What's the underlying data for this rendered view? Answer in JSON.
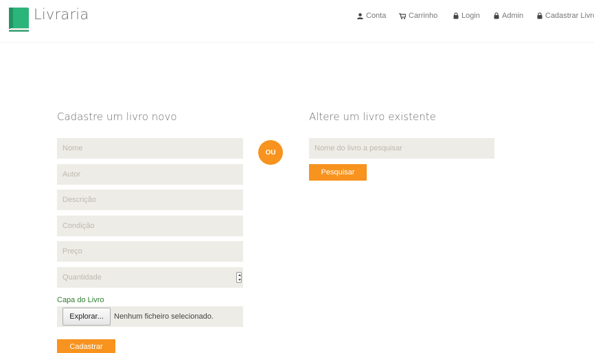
{
  "brand": {
    "name": "Livraria",
    "accent_color": "#f7931e",
    "logo_icon": "book-icon"
  },
  "nav": {
    "items": [
      {
        "label": "Conta",
        "icon": "user-icon"
      },
      {
        "label": "Carrinho",
        "icon": "cart-icon"
      },
      {
        "label": "Login",
        "icon": "lock-icon"
      },
      {
        "label": "Admin",
        "icon": "lock-icon"
      },
      {
        "label": "Cadastrar Livro",
        "icon": "lock-icon"
      }
    ]
  },
  "new_book": {
    "title": "Cadastre um livro novo",
    "fields": {
      "nome": "Nome",
      "autor": "Autor",
      "descricao": "Descrição",
      "condicao": "Condição",
      "preco": "Preço",
      "quantidade": "Quantidade"
    },
    "cover_label": "Capa do Livro",
    "file_button": "Explorar...",
    "file_status": "Nenhum ficheiro selecionado.",
    "submit_label": "Cadastrar"
  },
  "separator": {
    "label": "OU"
  },
  "edit_book": {
    "title": "Altere um livro existente",
    "search_placeholder": "Nome do livro a pesquisar",
    "search_button": "Pesquisar"
  }
}
